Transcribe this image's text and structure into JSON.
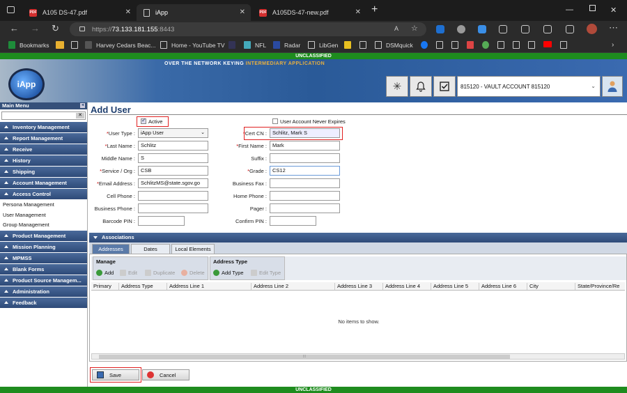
{
  "browser": {
    "tabs": [
      {
        "label": "A105 DS-47.pdf"
      },
      {
        "label": "iApp"
      },
      {
        "label": "A105DS-47-new.pdf"
      }
    ],
    "new_tab": "+",
    "url_scheme": "https://",
    "url_host": "73.133.181.155",
    "url_port": ":8443",
    "bookmarks": [
      {
        "label": "Bookmarks"
      },
      {
        "label": "Harvey Cedars Beac..."
      },
      {
        "label": "Home - YouTube TV"
      },
      {
        "label": "NFL"
      },
      {
        "label": "Radar"
      },
      {
        "label": "LibGen"
      },
      {
        "label": "DSMquick"
      }
    ]
  },
  "app": {
    "classification_top": "UNCLASSIFIED",
    "classification_bottom": "UNCLASSIFIED",
    "banner_text": "OVER THE NETWORK KEYING",
    "banner_highlight": "INTERMEDIARY APPLICATION",
    "logo_text": "iApp",
    "account_selector": "815120 - VAULT ACCOUNT 815120",
    "colors": {
      "classification": "#1e8c1e",
      "menu": "#35507a",
      "title": "#1f3f6f",
      "highlight": "#e02020"
    }
  },
  "sidebar": {
    "title": "Main Menu",
    "menus_top": [
      "Inventory Management",
      "Report Management",
      "Receive",
      "History",
      "Shipping",
      "Account Management",
      "Access Control"
    ],
    "subitems": [
      "Persona Management",
      "User Management",
      "Group Management"
    ],
    "menus_bottom": [
      "Product Management",
      "Mission Planning",
      "MPMSS",
      "Blank Forms",
      "Product Source Managem...",
      "Administration",
      "Feedback"
    ]
  },
  "form": {
    "title": "Add User",
    "active_label": "Active",
    "active_checked": true,
    "never_expires_label": "User Account Never Expires",
    "never_expires_checked": false,
    "fields": {
      "user_type": {
        "label": "User Type :",
        "value": "iApp User"
      },
      "last_name": {
        "label": "Last Name :",
        "value": "Schlitz"
      },
      "middle_name": {
        "label": "Middle Name :",
        "value": "S"
      },
      "service_org": {
        "label": "Service / Org :",
        "value": "CSB"
      },
      "email": {
        "label": "Email Address :",
        "value": "SchlitzMS@state.sgov.go"
      },
      "cell_phone": {
        "label": "Cell Phone :",
        "value": ""
      },
      "business_phone": {
        "label": "Business Phone :",
        "value": ""
      },
      "barcode_pin": {
        "label": "Barcode PIN :",
        "value": ""
      },
      "cert_cn": {
        "label": "Cert CN :",
        "value": "Schlitz, Mark S"
      },
      "first_name": {
        "label": "First Name :",
        "value": "Mark"
      },
      "suffix": {
        "label": "Suffix :",
        "value": ""
      },
      "grade": {
        "label": "Grade :",
        "value": "CS12"
      },
      "business_fax": {
        "label": "Business Fax :",
        "value": ""
      },
      "home_phone": {
        "label": "Home Phone :",
        "value": ""
      },
      "pager": {
        "label": "Pager :",
        "value": ""
      },
      "confirm_pin": {
        "label": "Confirm PIN :",
        "value": ""
      }
    }
  },
  "associations": {
    "title": "Associations",
    "tabs": [
      "Addresses",
      "Dates",
      "Local Elements"
    ],
    "manage": {
      "title": "Manage",
      "add": "Add",
      "edit": "Edit",
      "duplicate": "Duplicate",
      "delete": "Delete"
    },
    "address_type": {
      "title": "Address Type",
      "add": "Add Type",
      "edit": "Edit Type"
    },
    "columns": [
      "Primary",
      "Address Type",
      "Address Line 1",
      "Address Line 2",
      "Address Line 3",
      "Address Line 4",
      "Address Line 5",
      "Address Line 6",
      "City",
      "State/Province/Re"
    ],
    "empty_text": "No items to show."
  },
  "actions": {
    "save": "Save",
    "cancel": "Cancel"
  }
}
